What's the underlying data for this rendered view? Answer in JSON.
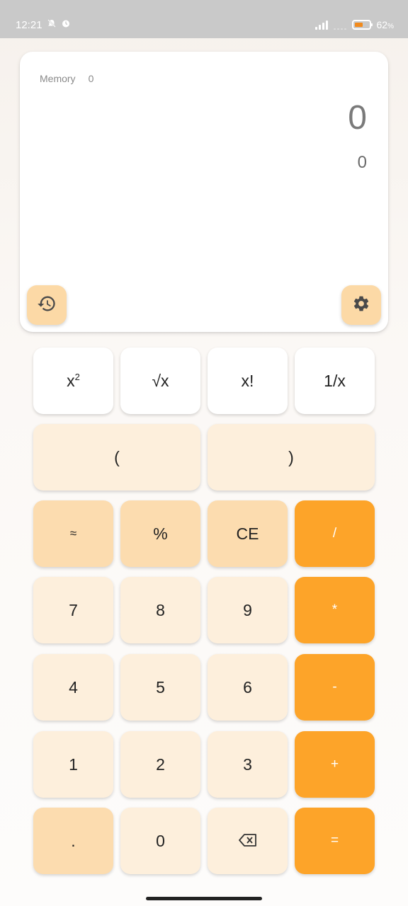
{
  "status_bar": {
    "time": "12:21",
    "battery_percent_number": "62",
    "battery_percent_sign": "%",
    "battery_level": 0.62,
    "icons": [
      "mute-icon",
      "alarm-icon",
      "signal-icon",
      "battery-icon"
    ]
  },
  "display": {
    "memory_label": "Memory",
    "memory_value": "0",
    "main_value": "0",
    "result_value": "0"
  },
  "keys": {
    "square_base": "x",
    "square_exp": "2",
    "sqrt": "√x",
    "factorial": "x!",
    "reciprocal": "1/x",
    "open_paren": "(",
    "close_paren": ")",
    "approx": "≈",
    "percent": "%",
    "clear_entry": "CE",
    "divide": "/",
    "seven": "7",
    "eight": "8",
    "nine": "9",
    "multiply": "*",
    "four": "4",
    "five": "5",
    "six": "6",
    "minus": "-",
    "one": "1",
    "two": "2",
    "three": "3",
    "plus": "+",
    "decimal": ".",
    "zero": "0",
    "equals": "="
  },
  "colors": {
    "operator": "#fda429",
    "function_tan": "#fcdcaf",
    "digit_cream": "#fdefdc",
    "scientific_white": "#ffffff"
  }
}
